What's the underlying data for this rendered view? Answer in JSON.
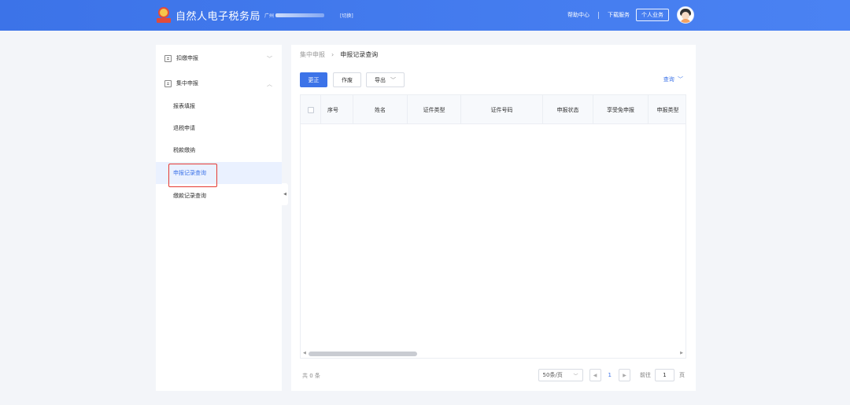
{
  "header": {
    "title": "自然人电子税务局",
    "region": "广州",
    "switch_label": "[切换]",
    "help_label": "帮助中心",
    "download_label": "下载服务",
    "personal_label": "个人业务"
  },
  "sidebar": {
    "groups": [
      {
        "label": "扣缴申报",
        "icon": "form-icon",
        "expanded": false
      },
      {
        "label": "集中申报",
        "icon": "form-icon",
        "expanded": true
      }
    ],
    "sub_items": [
      "报表填报",
      "退税申请",
      "税款缴纳",
      "申报记录查询",
      "缴款记录查询"
    ],
    "active_item": "申报记录查询"
  },
  "breadcrumb": {
    "parent": "集中申报",
    "current": "申报记录查询"
  },
  "toolbar": {
    "correct_label": "更正",
    "void_label": "作废",
    "export_label": "导出",
    "query_label": "查询"
  },
  "table": {
    "columns": [
      "序号",
      "姓名",
      "证件类型",
      "证件号码",
      "申报状态",
      "享受免申报",
      "申报类型"
    ],
    "rows": []
  },
  "pagination": {
    "total_text": "共 0 条",
    "page_size": "50条/页",
    "current_page": "1",
    "goto_label": "前往",
    "goto_value": "1",
    "page_unit": "页"
  },
  "colors": {
    "primary": "#3c73e8",
    "highlight_border": "#e53b33",
    "background": "#f3f5f9"
  }
}
